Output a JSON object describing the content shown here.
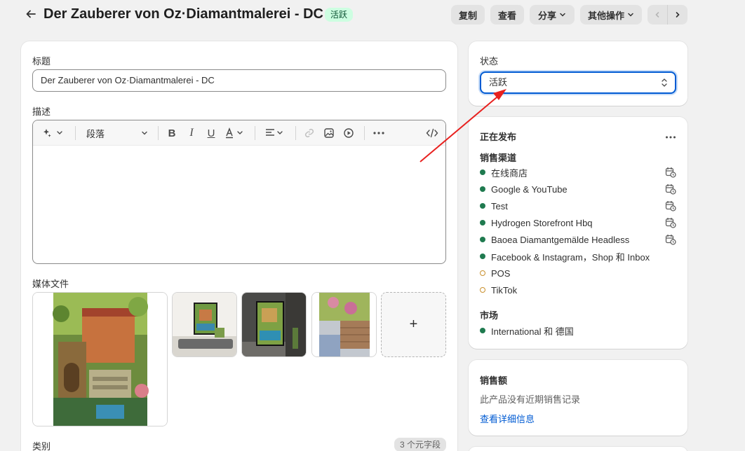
{
  "header": {
    "title": "Der Zauberer von Oz·Diamantmalerei - DC",
    "status_badge": "活跃",
    "duplicate": "复制",
    "view": "查看",
    "share": "分享",
    "more_actions": "其他操作"
  },
  "main": {
    "title_label": "标题",
    "title_value": "Der Zauberer von Oz·Diamantmalerei - DC",
    "description_label": "描述",
    "paragraph_select": "段落",
    "media_label": "媒体文件",
    "add_media": "+",
    "category_label": "类别",
    "metafield_badge": "3 个元字段"
  },
  "status_card": {
    "label": "状态",
    "value": "活跃"
  },
  "publishing": {
    "title": "正在发布",
    "channels_title": "销售渠道",
    "channels": [
      {
        "name": "在线商店",
        "active": true
      },
      {
        "name": "Google & YouTube",
        "active": true
      },
      {
        "name": "Test",
        "active": true
      },
      {
        "name": "Hydrogen Storefront Hbq",
        "active": true
      },
      {
        "name": "Baoea Diamantgemälde Headless",
        "active": true
      },
      {
        "name": "Facebook & Instagram，Shop 和 Inbox",
        "active": true
      },
      {
        "name": "POS",
        "active": false
      },
      {
        "name": "TikTok",
        "active": false
      }
    ],
    "markets_title": "市场",
    "markets": "International 和 德国"
  },
  "sales": {
    "title": "销售额",
    "empty_text": "此产品没有近期销售记录",
    "details_link": "查看详细信息"
  },
  "colors": {
    "accent": "#005bd3",
    "active_badge_bg": "#cdfee1",
    "active_dot": "#1f7a4f",
    "annotation_arrow": "#e8211f"
  }
}
